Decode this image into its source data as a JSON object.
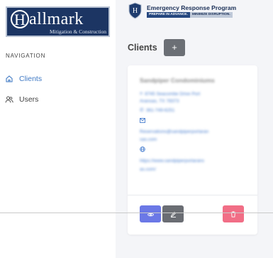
{
  "logo": {
    "initial": "H",
    "name": "allmark",
    "subtitle": "Mitigation & Construction"
  },
  "sidebar": {
    "section_title": "NAVIGATION",
    "items": [
      {
        "label": "Clients",
        "icon": "home-icon",
        "active": true
      },
      {
        "label": "Users",
        "icon": "users-icon",
        "active": false
      }
    ]
  },
  "header": {
    "program_title": "Emergency Response Program",
    "tagline_a": "PREPARE IN ADVANCE.",
    "tagline_b": "MINIMIZE DISRUPTION."
  },
  "page": {
    "title": "Clients",
    "add_label": "+"
  },
  "client_card": {
    "name": "Sandpiper Condominiums",
    "address_line1": "8745 Seacombe Drive Port",
    "address_line2": "Aransas, TX 78373",
    "phone": "361-749-6251",
    "email_line1": "Reservations@sandpiperportaran",
    "email_line2": "sas.com",
    "website_line1": "https://www.sandpiperportarans",
    "website_line2": "as.com/"
  },
  "colors": {
    "accent": "#3f79c4",
    "view_button": "#6b78e6",
    "edit_button": "#6a6d73",
    "delete_button": "#f16e86",
    "brand_navy": "#1c3563"
  }
}
